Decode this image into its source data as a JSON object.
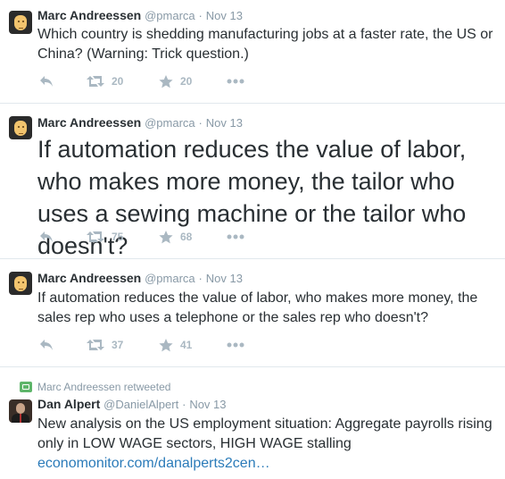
{
  "tweets": [
    {
      "name": "Marc Andreessen",
      "handle": "@pmarca",
      "date": "Nov 13",
      "text": "Which country is shedding manufacturing jobs at a faster rate, the US or China? (Warning: Trick question.)",
      "retweets": "20",
      "favorites": "20"
    },
    {
      "name": "Marc Andreessen",
      "handle": "@pmarca",
      "date": "Nov 13",
      "text": "If automation reduces the value of labor, who makes more money, the tailor who uses a sewing machine or the tailor who doesn't?",
      "retweets": "75",
      "favorites": "68"
    },
    {
      "name": "Marc Andreessen",
      "handle": "@pmarca",
      "date": "Nov 13",
      "text": "If automation reduces the value of labor, who makes more money, the sales rep who uses a telephone or the sales rep who doesn't?",
      "retweets": "37",
      "favorites": "41"
    },
    {
      "retweeted_by": "Marc Andreessen retweeted",
      "name": "Dan Alpert",
      "handle": "@DanielAlpert",
      "date": "Nov 13",
      "text": "New analysis on the US employment situation: Aggregate payrolls rising only in LOW WAGE sectors, HIGH WAGE stalling",
      "link": "economonitor.com/danalperts2cen…"
    }
  ],
  "separator": "·",
  "icons": [
    "reply-icon",
    "retweet-icon",
    "favorite-icon",
    "more-icon"
  ],
  "colors": {
    "link": "#2b7bb9",
    "muted": "#8899a6",
    "icon": "#aab8c2",
    "retweet_badge": "#5eb56a"
  }
}
